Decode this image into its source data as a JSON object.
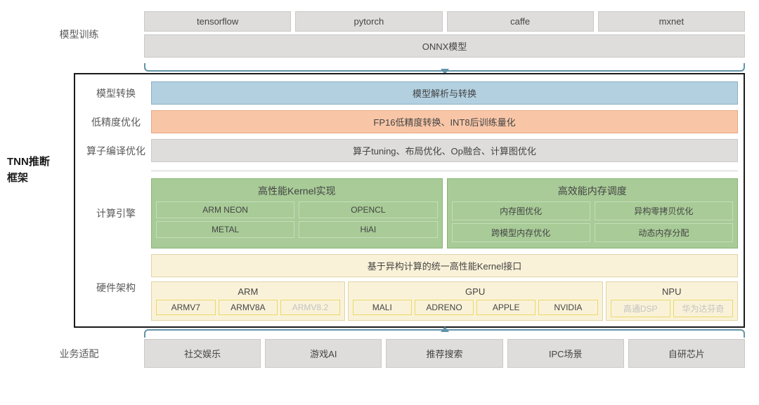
{
  "top": {
    "label": "模型训练",
    "frameworks": [
      "tensorflow",
      "pytorch",
      "caffe",
      "mxnet"
    ],
    "interchange": "ONNX模型"
  },
  "side_title": "TNN推断框架",
  "rows": {
    "convert": {
      "label": "模型转换",
      "text": "模型解析与转换"
    },
    "lowprec": {
      "label": "低精度优化",
      "text": "FP16低精度转换、INT8后训练量化"
    },
    "opopt": {
      "label": "算子编译优化",
      "text": "算子tuning、布局优化、Op融合、计算图优化"
    },
    "engine": {
      "label": "计算引擎",
      "left": {
        "title": "高性能Kernel实现",
        "items": [
          "ARM NEON",
          "OPENCL",
          "METAL",
          "HiAI"
        ]
      },
      "right": {
        "title": "高效能内存调度",
        "items": [
          "内存图优化",
          "异构零拷贝优化",
          "跨模型内存优化",
          "动态内存分配"
        ]
      }
    },
    "hw": {
      "label": "硬件架构",
      "header": "基于异构计算的统一高性能Kernel接口",
      "groups": {
        "arm": {
          "title": "ARM",
          "items": [
            "ARMV7",
            "ARMV8A",
            "ARMV8.2"
          ]
        },
        "gpu": {
          "title": "GPU",
          "items": [
            "MALI",
            "ADRENO",
            "APPLE",
            "NVIDIA"
          ]
        },
        "npu": {
          "title": "NPU",
          "items": [
            "高通DSP",
            "华为达芬奇"
          ]
        }
      }
    }
  },
  "bottom": {
    "label": "业务适配",
    "items": [
      "社交娱乐",
      "游戏AI",
      "推荐搜索",
      "IPC场景",
      "自研芯片"
    ]
  },
  "chart_data": {
    "type": "table",
    "title": "TNN推断框架 architecture",
    "layers": [
      {
        "name": "模型训练",
        "items": [
          "tensorflow",
          "pytorch",
          "caffe",
          "mxnet",
          "ONNX模型"
        ]
      },
      {
        "name": "模型转换",
        "items": [
          "模型解析与转换"
        ]
      },
      {
        "name": "低精度优化",
        "items": [
          "FP16低精度转换、INT8后训练量化"
        ]
      },
      {
        "name": "算子编译优化",
        "items": [
          "算子tuning",
          "布局优化",
          "Op融合",
          "计算图优化"
        ]
      },
      {
        "name": "计算引擎-高性能Kernel实现",
        "items": [
          "ARM NEON",
          "OPENCL",
          "METAL",
          "HiAI"
        ]
      },
      {
        "name": "计算引擎-高效能内存调度",
        "items": [
          "内存图优化",
          "异构零拷贝优化",
          "跨模型内存优化",
          "动态内存分配"
        ]
      },
      {
        "name": "硬件架构",
        "header": "基于异构计算的统一高性能Kernel接口",
        "ARM": [
          "ARMV7",
          "ARMV8A",
          "ARMV8.2"
        ],
        "GPU": [
          "MALI",
          "ADRENO",
          "APPLE",
          "NVIDIA"
        ],
        "NPU": [
          "高通DSP",
          "华为达芬奇"
        ]
      },
      {
        "name": "业务适配",
        "items": [
          "社交娱乐",
          "游戏AI",
          "推荐搜索",
          "IPC场景",
          "自研芯片"
        ]
      }
    ]
  }
}
